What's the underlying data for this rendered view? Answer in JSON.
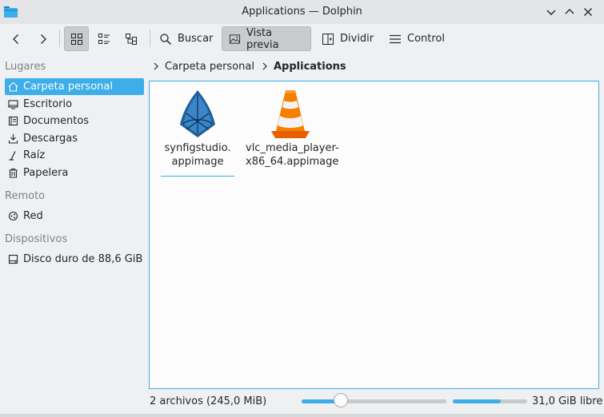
{
  "window": {
    "title": "Applications — Dolphin"
  },
  "toolbar": {
    "search_label": "Buscar",
    "preview_label": "Vista previa",
    "split_label": "Dividir",
    "control_label": "Control"
  },
  "sidebar": {
    "places_header": "Lugares",
    "places": [
      {
        "label": "Carpeta personal",
        "icon": "home-icon",
        "selected": true
      },
      {
        "label": "Escritorio",
        "icon": "desktop-icon"
      },
      {
        "label": "Documentos",
        "icon": "documents-icon"
      },
      {
        "label": "Descargas",
        "icon": "downloads-icon"
      },
      {
        "label": "Raíz",
        "icon": "root-icon"
      },
      {
        "label": "Papelera",
        "icon": "trash-icon"
      }
    ],
    "remote_header": "Remoto",
    "remote": [
      {
        "label": "Red",
        "icon": "network-icon"
      }
    ],
    "devices_header": "Dispositivos",
    "devices": [
      {
        "label": "Disco duro de 88,6 GiB",
        "icon": "harddisk-icon"
      }
    ]
  },
  "breadcrumb": {
    "items": [
      "Carpeta personal",
      "Applications"
    ]
  },
  "files": [
    {
      "line1": "synfigstudio.",
      "line2": "appimage",
      "icon": "synfig-icon"
    },
    {
      "line1": "vlc_media_player-",
      "line2": "x86_64.appimage",
      "icon": "vlc-cone-icon"
    }
  ],
  "status": {
    "summary": "2 archivos (245,0 MiB)",
    "free_space": "31,0 GiB libre",
    "zoom_level": 0.27,
    "space_used_fraction": 0.65
  },
  "colors": {
    "accent": "#3daee9",
    "window_bg": "#eff0f1",
    "view_bg": "#fcfcfc",
    "text": "#232627"
  }
}
